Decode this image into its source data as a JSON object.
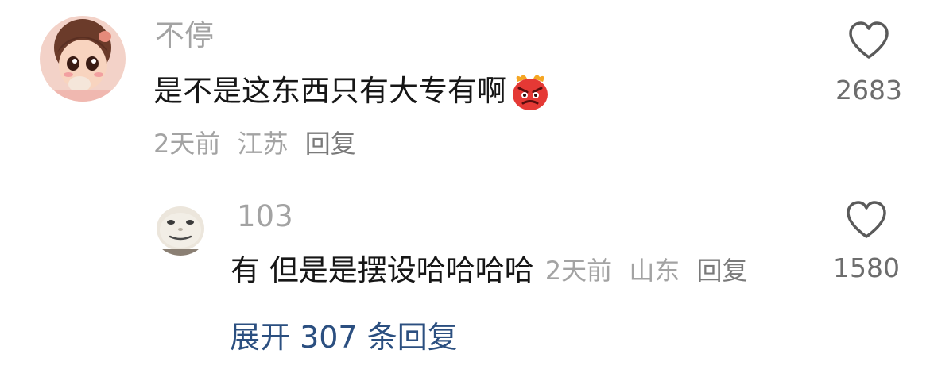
{
  "comment": {
    "username": "不停",
    "text": "是不是这东西只有大专有啊",
    "emoji": "angry-devil-emoji",
    "time": "2天前",
    "location": "江苏",
    "reply_label": "回复",
    "likes": "2683"
  },
  "reply": {
    "username": "103",
    "text": "有 但是是摆设哈哈哈哈",
    "time": "2天前",
    "location": "山东",
    "reply_label": "回复",
    "likes": "1580"
  },
  "expand": {
    "label": "展开 307 条回复"
  },
  "colors": {
    "username": "#a3a3a3",
    "text": "#161616",
    "link": "#2b4f80",
    "emoji_red": "#e53935"
  }
}
